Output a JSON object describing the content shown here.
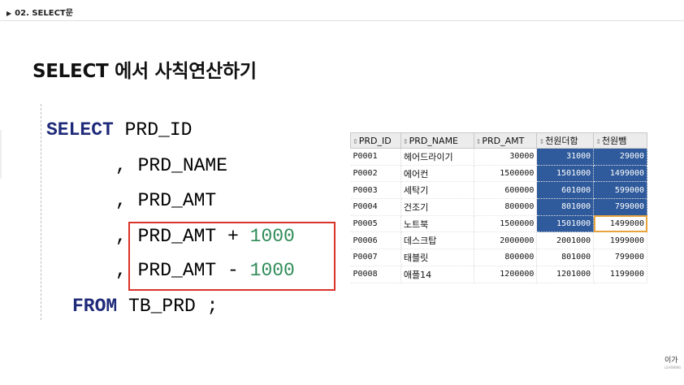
{
  "header": {
    "section_label": "02. SELECT문",
    "triangle": "▶"
  },
  "slide": {
    "title": "SELECT 에서 사칙연산하기"
  },
  "code": {
    "line1_kw": "SELECT",
    "line1_rest": " PRD_ID",
    "line2": ", PRD_NAME",
    "line3": ", PRD_AMT",
    "line4_text": ", PRD_AMT + ",
    "line4_num": "1000",
    "line5_text": ", PRD_AMT - ",
    "line5_num": "1000",
    "line6_kw": "FROM",
    "line6_rest": " TB_PRD ;"
  },
  "result": {
    "columns": [
      "PRD_ID",
      "PRD_NAME",
      "PRD_AMT",
      "천원더함",
      "천원뺌"
    ],
    "rows": [
      [
        "P0001",
        "헤어드라이기",
        "30000",
        "31000",
        "29000"
      ],
      [
        "P0002",
        "에어컨",
        "1500000",
        "1501000",
        "1499000"
      ],
      [
        "P0003",
        "세탁기",
        "600000",
        "601000",
        "599000"
      ],
      [
        "P0004",
        "건조기",
        "800000",
        "801000",
        "799000"
      ],
      [
        "P0005",
        "노트북",
        "1500000",
        "1501000",
        "1499000"
      ],
      [
        "P0006",
        "데스크탑",
        "2000000",
        "2001000",
        "1999000"
      ],
      [
        "P0007",
        "태블릿",
        "800000",
        "801000",
        "799000"
      ],
      [
        "P0008",
        "애플14",
        "1200000",
        "1201000",
        "1199000"
      ]
    ],
    "selection_color": "#2f5a9b",
    "cursor_color": "#e8a33d"
  },
  "footer": {
    "logo": "이가",
    "logo_sub": "LEARNING"
  }
}
